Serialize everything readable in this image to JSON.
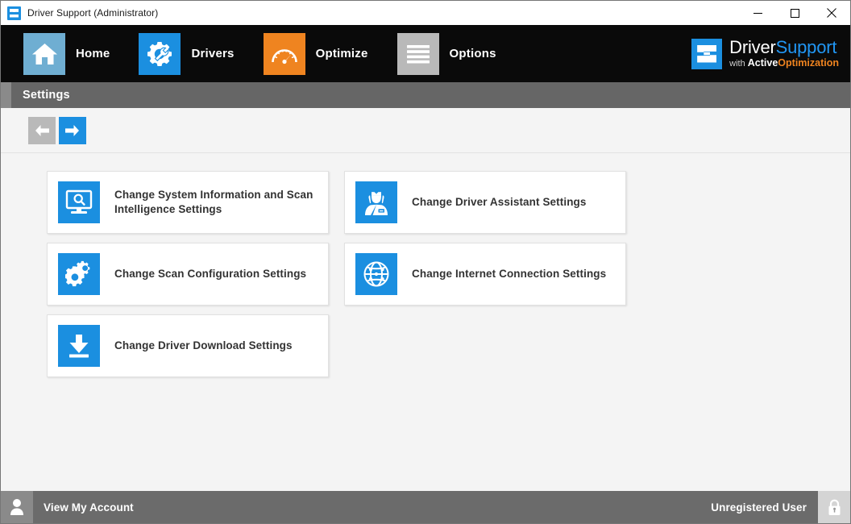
{
  "window": {
    "title": "Driver Support (Administrator)",
    "app_icon": "driver-support-logo-icon",
    "controls": {
      "minimize": "minimize-icon",
      "maximize": "maximize-icon",
      "close": "close-icon"
    }
  },
  "navbar": {
    "items": [
      {
        "label": "Home",
        "icon": "house-icon",
        "color": "#6faed2"
      },
      {
        "label": "Drivers",
        "icon": "gear-wrench-icon",
        "color": "#1b8fe0"
      },
      {
        "label": "Optimize",
        "icon": "speedometer-icon",
        "color": "#ef8420"
      },
      {
        "label": "Options",
        "icon": "hamburger-menu-icon",
        "color": "#b9b9b9"
      }
    ],
    "brand": {
      "line1_part1": "Driver",
      "line1_part2": "Support",
      "line2_prefix": "with ",
      "line2_part1": "Active",
      "line2_part2": "Optimization",
      "icon": "driver-support-logo-icon"
    }
  },
  "section": {
    "title": "Settings"
  },
  "toolbar": {
    "back_label": "back-arrow-icon",
    "forward_label": "forward-arrow-icon"
  },
  "cards": [
    {
      "label": "Change System Information and Scan Intelligence Settings",
      "icon": "monitor-search-icon",
      "column": "left"
    },
    {
      "label": "Change Scan Configuration Settings",
      "icon": "gears-icon",
      "column": "left"
    },
    {
      "label": "Change Driver Download Settings",
      "icon": "download-icon",
      "column": "left"
    },
    {
      "label": "Change Driver Assistant Settings",
      "icon": "assistant-person-icon",
      "column": "right"
    },
    {
      "label": "Change Internet Connection Settings",
      "icon": "globe-icon",
      "column": "right"
    }
  ],
  "statusbar": {
    "avatar_icon": "user-avatar-icon",
    "account_label": "View My Account",
    "user_status": "Unregistered User",
    "lock_icon": "lock-icon"
  },
  "colors": {
    "accent_blue": "#1b8fe0",
    "accent_orange": "#ef8420",
    "nav_background": "#0a0a0a",
    "header_gray": "#666666",
    "content_background": "#f4f4f4"
  }
}
